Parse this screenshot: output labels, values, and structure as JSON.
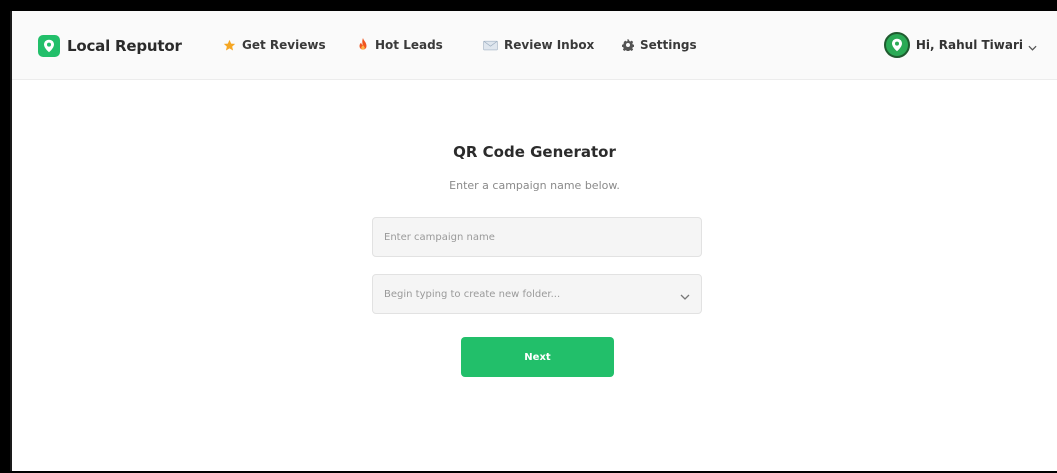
{
  "app": {
    "name": "Local Reputor"
  },
  "nav": {
    "items": [
      {
        "label": "Get Reviews",
        "icon": "star-icon"
      },
      {
        "label": "Hot Leads",
        "icon": "fire-icon"
      },
      {
        "label": "Review Inbox",
        "icon": "envelope-icon"
      },
      {
        "label": "Settings",
        "icon": "gear-icon"
      }
    ]
  },
  "user": {
    "greeting": "Hi, Rahul Tiwari"
  },
  "main": {
    "title": "QR Code Generator",
    "subtitle": "Enter a campaign name below.",
    "campaign_input": {
      "placeholder": "Enter campaign name",
      "value": ""
    },
    "folder_select": {
      "placeholder": "Begin typing to create new folder..."
    },
    "next_label": "Next"
  },
  "colors": {
    "accent": "#22bf6a",
    "star": "#f5a623",
    "fire": "#f0541e"
  }
}
